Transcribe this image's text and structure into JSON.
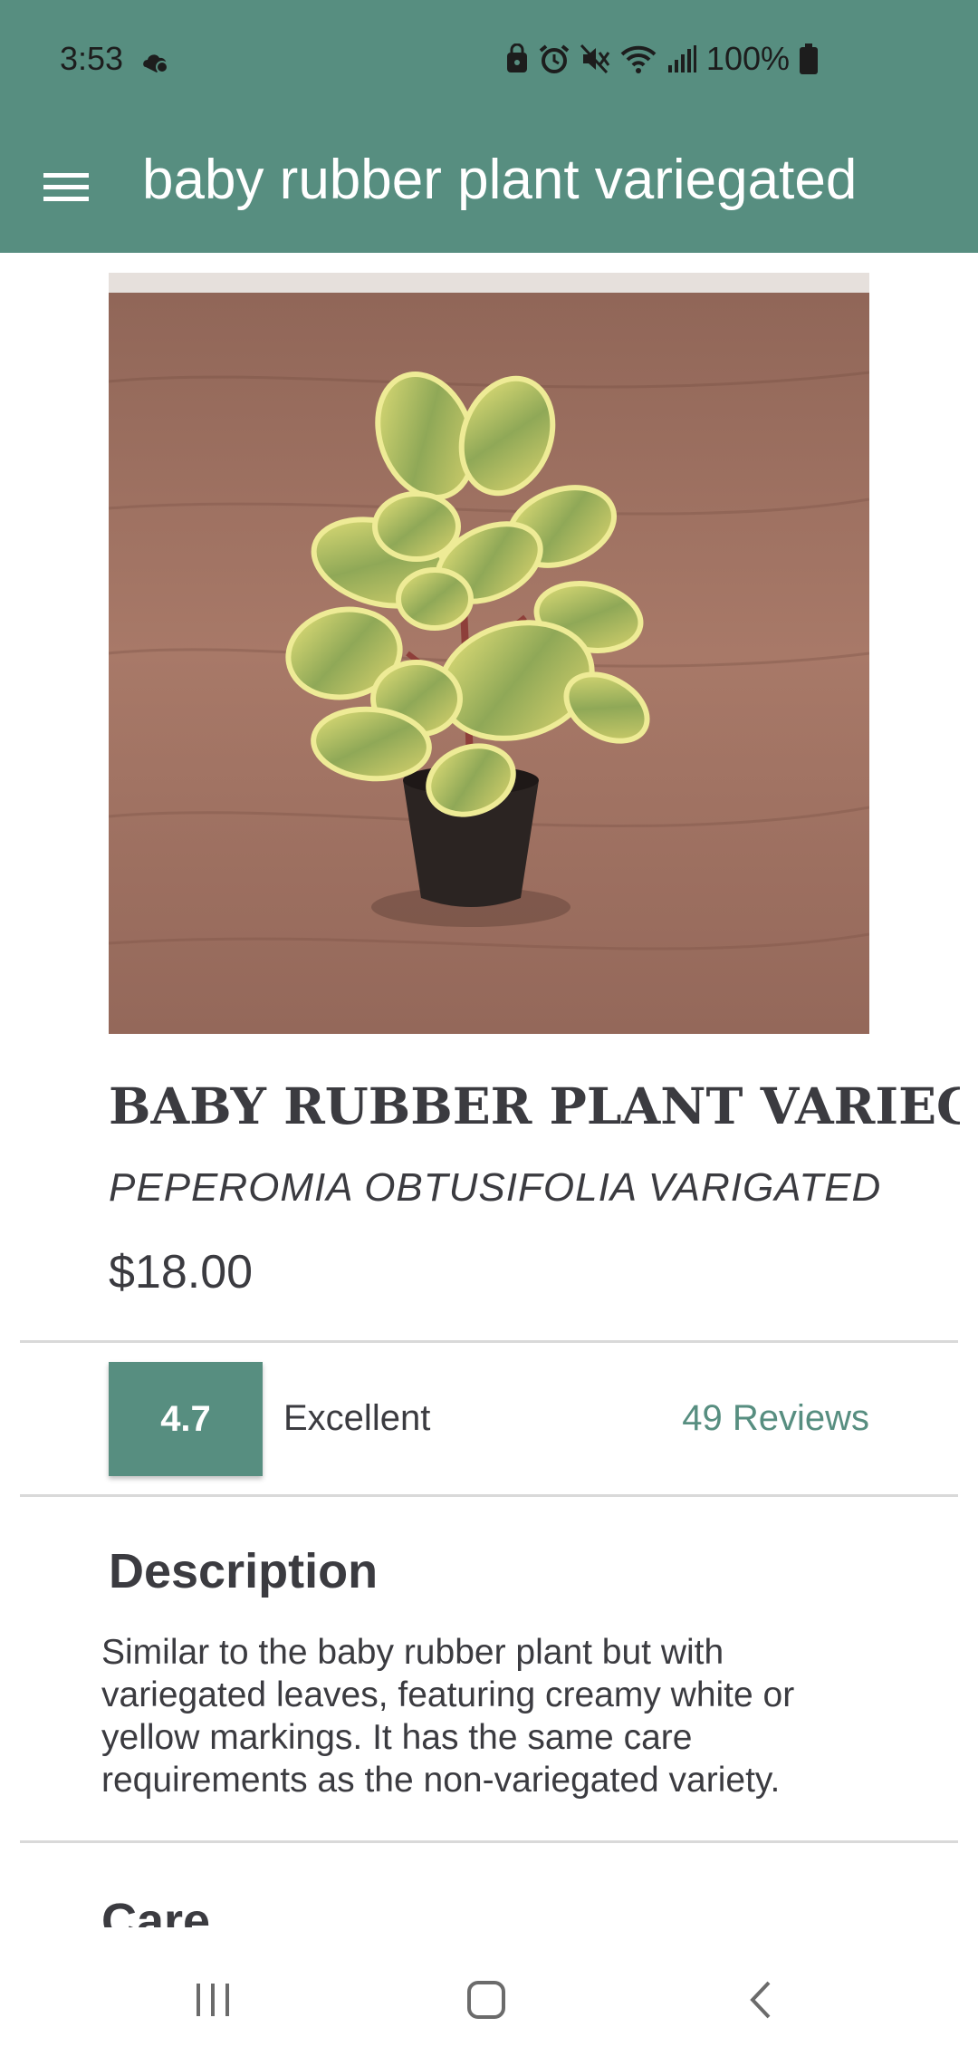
{
  "status_bar": {
    "time": "3:53",
    "battery": "100%"
  },
  "toolbar": {
    "title": "baby rubber plant variegated"
  },
  "product": {
    "name": "BABY RUBBER PLANT VARIEGATED",
    "scientific_name": "PEPEROMIA OBTUSIFOLIA VARIGATED",
    "price": "$18.00"
  },
  "rating": {
    "score": "4.7",
    "label": "Excellent",
    "reviews": "49 Reviews"
  },
  "description": {
    "heading": "Description",
    "text": "Similar to the baby rubber plant but with variegated leaves, featuring creamy white or yellow markings. It has the same care requirements as the non-variegated variety."
  },
  "care": {
    "heading": "Care"
  },
  "icons": {
    "menu": "menu-icon",
    "recents": "recents-icon",
    "home": "home-icon",
    "back": "back-icon"
  },
  "colors": {
    "accent": "#578e80",
    "text": "#3b3b40"
  }
}
